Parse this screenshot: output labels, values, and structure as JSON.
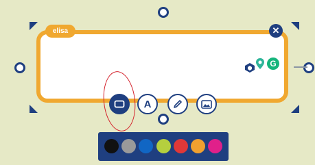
{
  "note": {
    "author": "elisa"
  },
  "colors": {
    "note_border": "#f0a830",
    "accent": "#1f3f80",
    "background": "#e6e9c6"
  },
  "toolbar": {
    "tools": [
      {
        "name": "rectangle-shape",
        "icon": "rectangle-icon",
        "active": true
      },
      {
        "name": "text",
        "icon": "text-a-icon",
        "active": false
      },
      {
        "name": "pen",
        "icon": "pencil-icon",
        "active": false
      },
      {
        "name": "image",
        "icon": "image-icon",
        "active": false
      }
    ]
  },
  "palette": {
    "swatches": [
      "#111111",
      "#9a9a9a",
      "#1166c4",
      "#b5cf3e",
      "#e03838",
      "#f0a030",
      "#e0208a"
    ]
  },
  "avatars": [
    {
      "name": "connector-app-icon",
      "color": "#1f3f80"
    },
    {
      "name": "location-pin-icon",
      "color": "#2fb59a"
    },
    {
      "name": "grammarly-icon",
      "color": "#15b57c"
    }
  ]
}
